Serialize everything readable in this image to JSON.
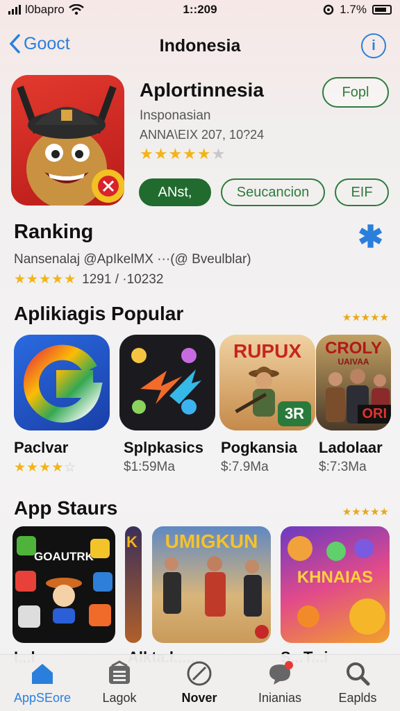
{
  "status_bar": {
    "carrier": "l0bapro",
    "time": "1::209",
    "battery": "1.7%"
  },
  "nav": {
    "back_label": "Gooct",
    "title": "Indonesia",
    "info_label": "i"
  },
  "hero": {
    "title": "Aplortinnesia",
    "subtitle": "Insponasian",
    "meta": "ANNA\\EIX 207, 10?24",
    "rating": 4.5,
    "get_button": "Fopl",
    "actions": [
      "ANst,",
      "Seucancion",
      "EIF"
    ]
  },
  "ranking": {
    "title": "Ranking",
    "subtitle": "Nansenalaj @ApIkelMX ···(@ Bveulblar)",
    "rating_text": "1291 / ·10232",
    "rating": 5
  },
  "popular": {
    "title": "Aplikiagis Popular",
    "apps": [
      {
        "name": "Paclvar",
        "rating": 4,
        "tile": "Google-style G"
      },
      {
        "name": "Splpkasics",
        "price": "$1:59Ma"
      },
      {
        "name": "Pogkansia",
        "price": "$:7.9Ma",
        "tile_text": "RUPUX",
        "badge": "3R"
      },
      {
        "name": "Ladolaar",
        "price": "$:7:3Ma",
        "tile_text": "CROLY",
        "tile_sub": "UAIVAA",
        "badge": "ORI"
      }
    ]
  },
  "stories": {
    "title": "App Staurs",
    "cards": [
      {
        "label": "I...l",
        "tile_text": "GOAUTRK"
      },
      {
        "label": "",
        "tile_text": "K"
      },
      {
        "label": "Alkta.l.......",
        "tile_text": "UMIGKUN"
      },
      {
        "label": "S...T...i",
        "tile_text": "KHNAIAS"
      }
    ]
  },
  "tab_bar": [
    {
      "label": "AppSEore",
      "icon": "home-icon",
      "active": true
    },
    {
      "label": "Lagok",
      "icon": "layers-icon"
    },
    {
      "label": "Nover",
      "icon": "slash-circle-icon",
      "bold": true
    },
    {
      "label": "Inianias",
      "icon": "chat-bubble-icon"
    },
    {
      "label": "Eaplds",
      "icon": "search-icon"
    }
  ],
  "colors": {
    "accent_blue": "#2a7fdc",
    "accent_green": "#216b2f",
    "star": "#f2b418"
  }
}
